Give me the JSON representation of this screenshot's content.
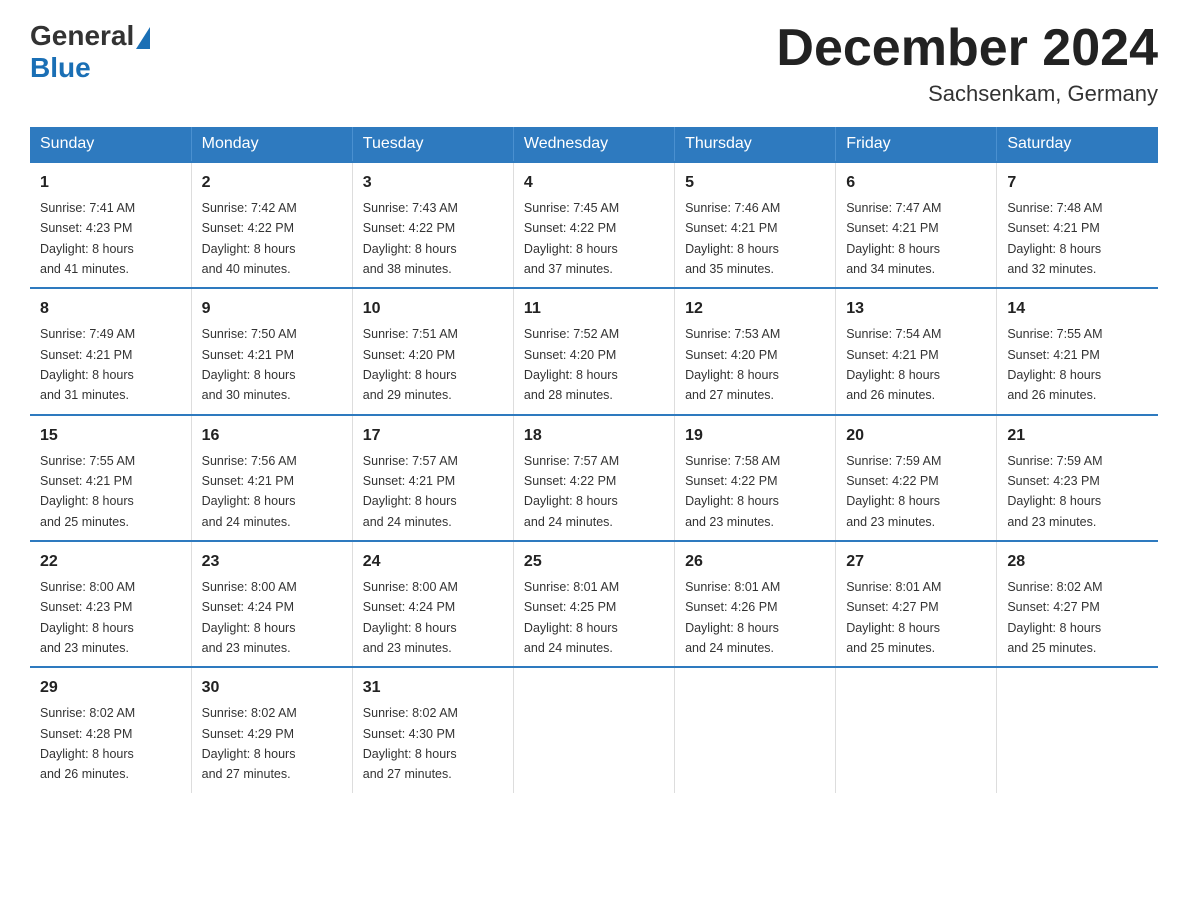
{
  "header": {
    "logo_general": "General",
    "logo_blue": "Blue",
    "month_title": "December 2024",
    "location": "Sachsenkam, Germany"
  },
  "weekdays": [
    "Sunday",
    "Monday",
    "Tuesday",
    "Wednesday",
    "Thursday",
    "Friday",
    "Saturday"
  ],
  "weeks": [
    [
      {
        "day": "1",
        "sunrise": "7:41 AM",
        "sunset": "4:23 PM",
        "daylight": "8 hours and 41 minutes."
      },
      {
        "day": "2",
        "sunrise": "7:42 AM",
        "sunset": "4:22 PM",
        "daylight": "8 hours and 40 minutes."
      },
      {
        "day": "3",
        "sunrise": "7:43 AM",
        "sunset": "4:22 PM",
        "daylight": "8 hours and 38 minutes."
      },
      {
        "day": "4",
        "sunrise": "7:45 AM",
        "sunset": "4:22 PM",
        "daylight": "8 hours and 37 minutes."
      },
      {
        "day": "5",
        "sunrise": "7:46 AM",
        "sunset": "4:21 PM",
        "daylight": "8 hours and 35 minutes."
      },
      {
        "day": "6",
        "sunrise": "7:47 AM",
        "sunset": "4:21 PM",
        "daylight": "8 hours and 34 minutes."
      },
      {
        "day": "7",
        "sunrise": "7:48 AM",
        "sunset": "4:21 PM",
        "daylight": "8 hours and 32 minutes."
      }
    ],
    [
      {
        "day": "8",
        "sunrise": "7:49 AM",
        "sunset": "4:21 PM",
        "daylight": "8 hours and 31 minutes."
      },
      {
        "day": "9",
        "sunrise": "7:50 AM",
        "sunset": "4:21 PM",
        "daylight": "8 hours and 30 minutes."
      },
      {
        "day": "10",
        "sunrise": "7:51 AM",
        "sunset": "4:20 PM",
        "daylight": "8 hours and 29 minutes."
      },
      {
        "day": "11",
        "sunrise": "7:52 AM",
        "sunset": "4:20 PM",
        "daylight": "8 hours and 28 minutes."
      },
      {
        "day": "12",
        "sunrise": "7:53 AM",
        "sunset": "4:20 PM",
        "daylight": "8 hours and 27 minutes."
      },
      {
        "day": "13",
        "sunrise": "7:54 AM",
        "sunset": "4:21 PM",
        "daylight": "8 hours and 26 minutes."
      },
      {
        "day": "14",
        "sunrise": "7:55 AM",
        "sunset": "4:21 PM",
        "daylight": "8 hours and 26 minutes."
      }
    ],
    [
      {
        "day": "15",
        "sunrise": "7:55 AM",
        "sunset": "4:21 PM",
        "daylight": "8 hours and 25 minutes."
      },
      {
        "day": "16",
        "sunrise": "7:56 AM",
        "sunset": "4:21 PM",
        "daylight": "8 hours and 24 minutes."
      },
      {
        "day": "17",
        "sunrise": "7:57 AM",
        "sunset": "4:21 PM",
        "daylight": "8 hours and 24 minutes."
      },
      {
        "day": "18",
        "sunrise": "7:57 AM",
        "sunset": "4:22 PM",
        "daylight": "8 hours and 24 minutes."
      },
      {
        "day": "19",
        "sunrise": "7:58 AM",
        "sunset": "4:22 PM",
        "daylight": "8 hours and 23 minutes."
      },
      {
        "day": "20",
        "sunrise": "7:59 AM",
        "sunset": "4:22 PM",
        "daylight": "8 hours and 23 minutes."
      },
      {
        "day": "21",
        "sunrise": "7:59 AM",
        "sunset": "4:23 PM",
        "daylight": "8 hours and 23 minutes."
      }
    ],
    [
      {
        "day": "22",
        "sunrise": "8:00 AM",
        "sunset": "4:23 PM",
        "daylight": "8 hours and 23 minutes."
      },
      {
        "day": "23",
        "sunrise": "8:00 AM",
        "sunset": "4:24 PM",
        "daylight": "8 hours and 23 minutes."
      },
      {
        "day": "24",
        "sunrise": "8:00 AM",
        "sunset": "4:24 PM",
        "daylight": "8 hours and 23 minutes."
      },
      {
        "day": "25",
        "sunrise": "8:01 AM",
        "sunset": "4:25 PM",
        "daylight": "8 hours and 24 minutes."
      },
      {
        "day": "26",
        "sunrise": "8:01 AM",
        "sunset": "4:26 PM",
        "daylight": "8 hours and 24 minutes."
      },
      {
        "day": "27",
        "sunrise": "8:01 AM",
        "sunset": "4:27 PM",
        "daylight": "8 hours and 25 minutes."
      },
      {
        "day": "28",
        "sunrise": "8:02 AM",
        "sunset": "4:27 PM",
        "daylight": "8 hours and 25 minutes."
      }
    ],
    [
      {
        "day": "29",
        "sunrise": "8:02 AM",
        "sunset": "4:28 PM",
        "daylight": "8 hours and 26 minutes."
      },
      {
        "day": "30",
        "sunrise": "8:02 AM",
        "sunset": "4:29 PM",
        "daylight": "8 hours and 27 minutes."
      },
      {
        "day": "31",
        "sunrise": "8:02 AM",
        "sunset": "4:30 PM",
        "daylight": "8 hours and 27 minutes."
      },
      null,
      null,
      null,
      null
    ]
  ],
  "labels": {
    "sunrise": "Sunrise:",
    "sunset": "Sunset:",
    "daylight": "Daylight:"
  }
}
